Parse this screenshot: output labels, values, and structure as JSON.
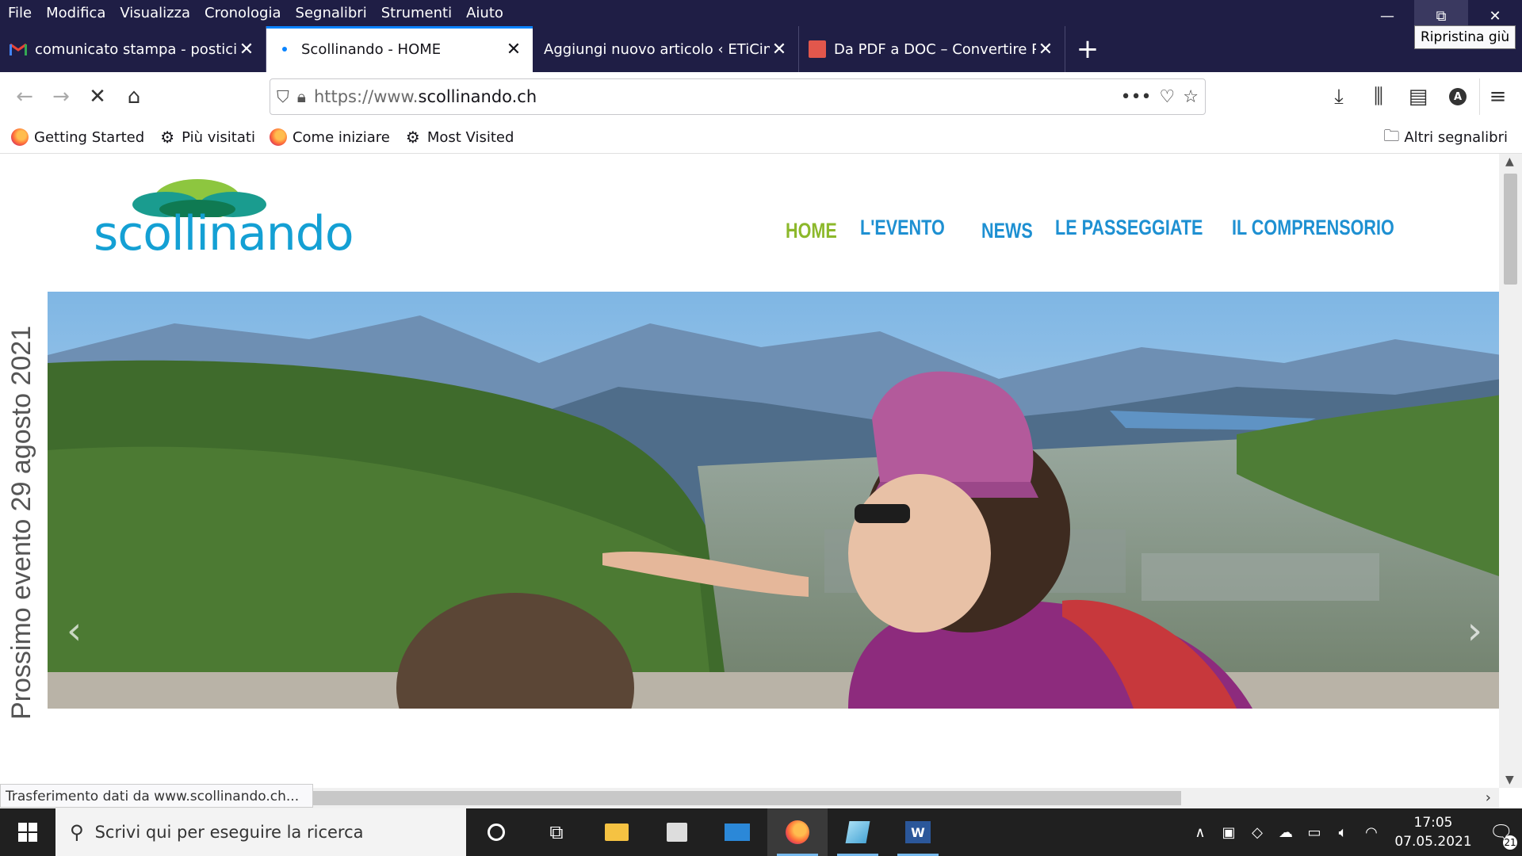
{
  "menu": [
    "File",
    "Modifica",
    "Visualizza",
    "Cronologia",
    "Segnalibri",
    "Strumenti",
    "Aiuto"
  ],
  "window_controls": {
    "tooltip": "Ripristina giù"
  },
  "tabs": [
    {
      "title": "comunicato stampa - posticipo",
      "icon": "gmail-icon"
    },
    {
      "title": "Scollinando - HOME",
      "icon": "loading-dot-icon",
      "active": true
    },
    {
      "title": "Aggiungi nuovo articolo ‹ ETiCinfor",
      "icon": "none"
    },
    {
      "title": "Da PDF a DOC – Convertire PDF",
      "icon": "pdf-doc-icon"
    }
  ],
  "url": {
    "prefix": "https://www.",
    "domain": "scollinando.ch"
  },
  "bookmarks": [
    {
      "label": "Getting Started",
      "icon": "firefox-icon"
    },
    {
      "label": "Più visitati",
      "icon": "gear-icon"
    },
    {
      "label": "Come iniziare",
      "icon": "firefox-icon"
    },
    {
      "label": "Most Visited",
      "icon": "gear-icon"
    }
  ],
  "bookmarks_other": "Altri segnalibri",
  "site": {
    "logo_text": "scollinando",
    "nav": [
      "HOME",
      "L'EVENTO",
      "NEWS",
      "LE PASSEGGIATE",
      "IL COMPRENSORIO"
    ],
    "vertical_text": "Prossimo evento 29 agosto 2021"
  },
  "status_text": "Trasferimento dati da www.scollinando.ch...",
  "taskbar": {
    "search_placeholder": "Scrivi qui per eseguire la ricerca",
    "time": "17:05",
    "date": "07.05.2021",
    "notifications": "21"
  }
}
